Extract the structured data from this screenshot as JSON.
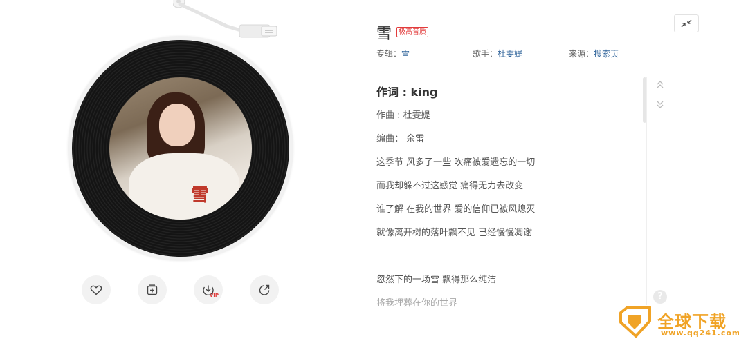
{
  "player": {
    "cover_mark": "雪",
    "controls": [
      {
        "name": "like",
        "icon": "heart-icon"
      },
      {
        "name": "add-to-playlist",
        "icon": "add-box-icon"
      },
      {
        "name": "download",
        "icon": "download-icon",
        "badge": "VIP"
      },
      {
        "name": "share",
        "icon": "share-icon"
      }
    ]
  },
  "song": {
    "title": "雪",
    "quality_badge": "极高音质",
    "album_label": "专辑：",
    "album": "雪",
    "singer_label": "歌手：",
    "singer": "杜雯媞",
    "source_label": "来源：",
    "source": "搜索页"
  },
  "lyrics": [
    "作词 : king",
    "作曲 : 杜雯媞",
    "编曲： 余雷",
    "这季节 风多了一些 吹痛被爱遗忘的一切",
    "而我却躲不过这感觉 痛得无力去改变",
    "谁了解 在我的世界 爱的信仰已被风熄灭",
    "就像离开树的落叶飘不见 已经慢慢凋谢",
    "",
    "忽然下的一场雪 飘得那么纯洁",
    "将我埋葬在你的世界"
  ],
  "help": "?",
  "watermark": {
    "text": "全球下载",
    "url": "www.qq241.com"
  },
  "colors": {
    "accent_red": "#e23c3c",
    "link_blue": "#31659b",
    "watermark_orange": "#f0a326"
  }
}
